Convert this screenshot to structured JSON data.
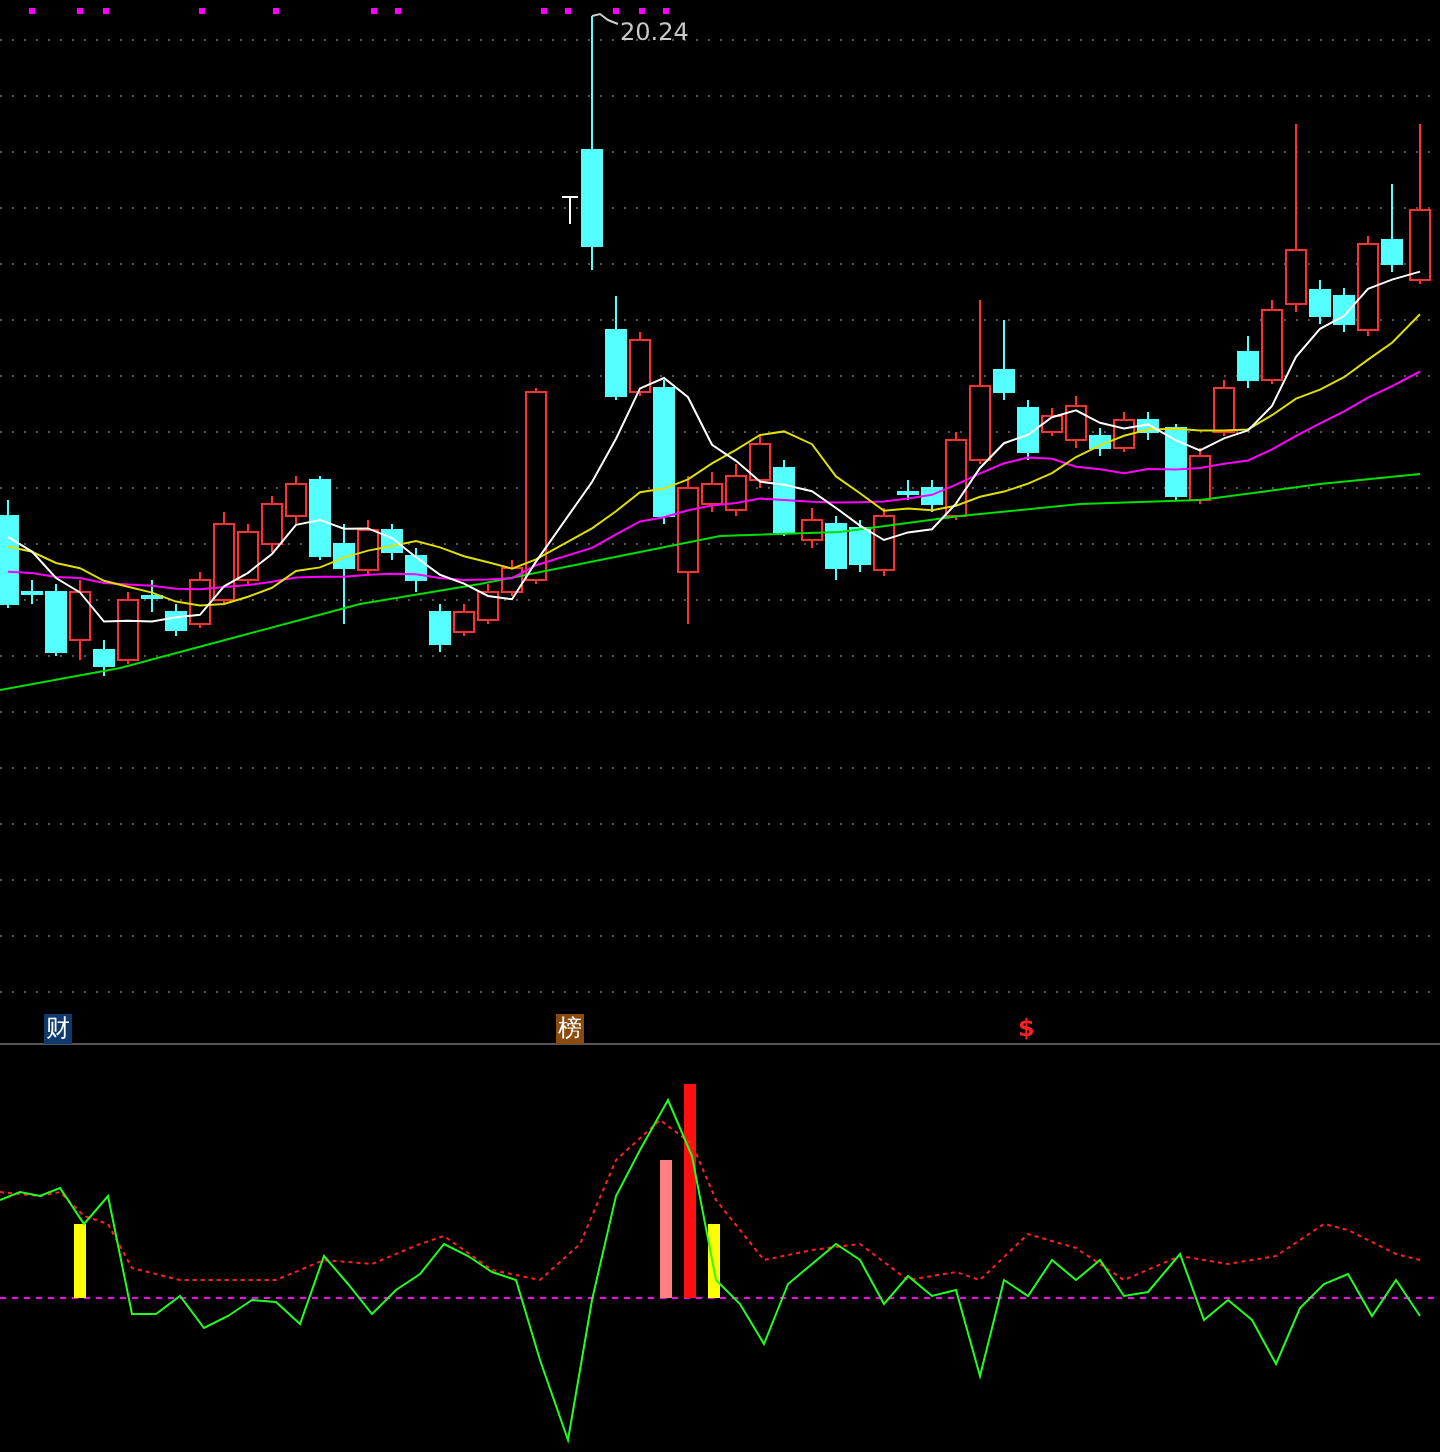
{
  "price_chart": {
    "high_label": "20.24"
  },
  "markers": [
    {
      "text": "财",
      "kind": "badge",
      "color": "#0e3a6e"
    },
    {
      "text": "榜",
      "kind": "badge",
      "color": "#8a4a10"
    },
    {
      "text": "$",
      "kind": "plain",
      "color": "#ff2020"
    }
  ]
}
